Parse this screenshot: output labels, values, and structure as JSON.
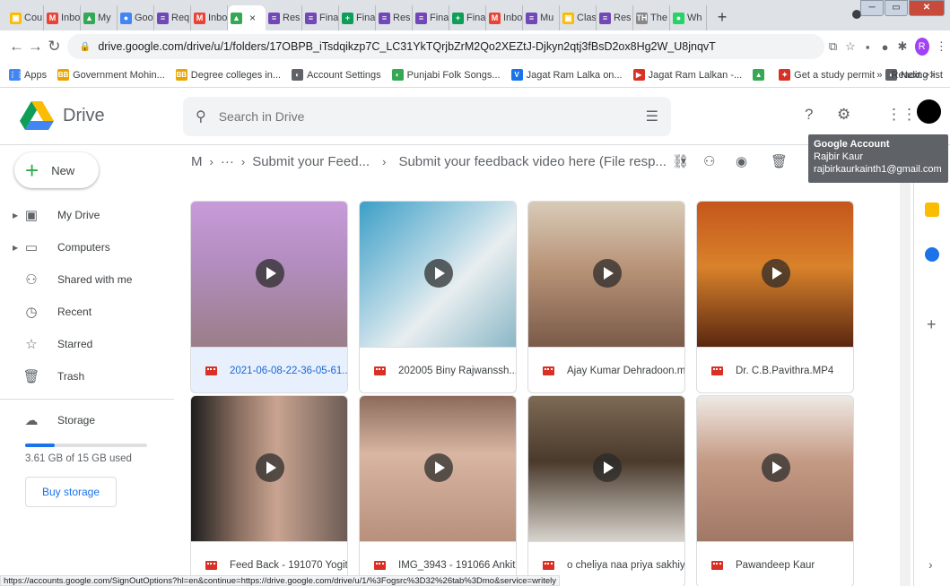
{
  "tabs": [
    {
      "label": "Cou",
      "color": "#fbbc04",
      "glyph": "▣"
    },
    {
      "label": "Inbo",
      "color": "#ea4335",
      "glyph": "M"
    },
    {
      "label": "My",
      "color": "#34a853",
      "glyph": "▲"
    },
    {
      "label": "Goo",
      "color": "#4285f4",
      "glyph": "●"
    },
    {
      "label": "Req",
      "color": "#7248b9",
      "glyph": "≡"
    },
    {
      "label": "Inbo",
      "color": "#ea4335",
      "glyph": "M"
    },
    {
      "label": "",
      "color": "#34a853",
      "glyph": "▲",
      "active": true
    },
    {
      "label": "Res",
      "color": "#7248b9",
      "glyph": "≡"
    },
    {
      "label": "Fina",
      "color": "#7248b9",
      "glyph": "≡"
    },
    {
      "label": "Fina",
      "color": "#0f9d58",
      "glyph": "+"
    },
    {
      "label": "Res",
      "color": "#7248b9",
      "glyph": "≡"
    },
    {
      "label": "Fina",
      "color": "#7248b9",
      "glyph": "≡"
    },
    {
      "label": "Fina",
      "color": "#0f9d58",
      "glyph": "+"
    },
    {
      "label": "Inbo",
      "color": "#ea4335",
      "glyph": "M"
    },
    {
      "label": "Mu",
      "color": "#7248b9",
      "glyph": "≡"
    },
    {
      "label": "Clas",
      "color": "#fbbc04",
      "glyph": "▣"
    },
    {
      "label": "Res",
      "color": "#7248b9",
      "glyph": "≡"
    },
    {
      "label": "The",
      "color": "#888888",
      "glyph": "TH"
    },
    {
      "label": "Wh",
      "color": "#25d366",
      "glyph": "●"
    }
  ],
  "address": {
    "url": "drive.google.com/drive/u/1/folders/17OBPB_iTsdqikzp7C_LC31YkTQrjbZrM2Qo2XEZtJ-Djkyn2qtj3fBsD2ox8Hg2W_U8jnqvT"
  },
  "bookmarks": [
    {
      "label": "Apps",
      "color": "#4285f4",
      "glyph": "⋮⋮"
    },
    {
      "label": "Government Mohin...",
      "color": "#e8a400",
      "glyph": "BB"
    },
    {
      "label": "Degree colleges in...",
      "color": "#e8a400",
      "glyph": "BB"
    },
    {
      "label": "Account Settings",
      "color": "#5f6368",
      "glyph": "◐"
    },
    {
      "label": "Punjabi Folk Songs...",
      "color": "#34a853",
      "glyph": "◐"
    },
    {
      "label": "Jagat Ram Lalka on...",
      "color": "#1a73e8",
      "glyph": "V"
    },
    {
      "label": "Jagat Ram Lalkan -...",
      "color": "#d93025",
      "glyph": "▶"
    },
    {
      "label": "",
      "color": "#34a853",
      "glyph": "▲"
    },
    {
      "label": "Get a study permit",
      "color": "#d93025",
      "glyph": "✦"
    },
    {
      "label": "Next >>",
      "color": "#5f6368",
      "glyph": "◐"
    }
  ],
  "bookmarks_more": "»",
  "reading_list": "Reading list",
  "drive": {
    "app_name": "Drive",
    "search_placeholder": "Search in Drive",
    "new_label": "New"
  },
  "account_tooltip": {
    "title": "Google Account",
    "name": "Rajbir Kaur",
    "email": "rajbirkaurkainth1@gmail.com"
  },
  "nav": [
    {
      "label": "My Drive",
      "icon": "my-drive-icon",
      "glyph": "▣",
      "caret": true
    },
    {
      "label": "Computers",
      "icon": "computer-icon",
      "glyph": "▭",
      "caret": true
    },
    {
      "label": "Shared with me",
      "icon": "shared-icon",
      "glyph": "⚇",
      "caret": false
    },
    {
      "label": "Recent",
      "icon": "clock-icon",
      "glyph": "◷",
      "caret": false
    },
    {
      "label": "Starred",
      "icon": "star-icon",
      "glyph": "☆",
      "caret": false
    },
    {
      "label": "Trash",
      "icon": "trash-icon",
      "glyph": "🗑",
      "caret": false
    }
  ],
  "storage": {
    "label": "Storage",
    "used_text": "3.61 GB of 15 GB used",
    "fraction_used": 0.24,
    "buy_label": "Buy storage"
  },
  "breadcrumb": {
    "root": "M",
    "ellipsis": "···",
    "folder1": "Submit your Feed...",
    "folder2": "Submit your feedback video here (File resp..."
  },
  "files": [
    {
      "name": "2021-06-08-22-36-05-61...",
      "selected": true,
      "bg": "linear-gradient(180deg,#c79bd8 0%,#b48ec2 40%,#9a7e88 100%)"
    },
    {
      "name": "202005 Biny Rajwanssh...",
      "selected": false,
      "bg": "linear-gradient(135deg,#3c9fc7 0%,#b9d9e6 45%,#e8eef0 60%,#8ab7c6 100%)"
    },
    {
      "name": "Ajay Kumar Dehradoon.m...",
      "selected": false,
      "bg": "linear-gradient(180deg,#d8cbb8 0%,#b99478 45%,#7a5a48 100%)"
    },
    {
      "name": "Dr. C.B.Pavithra.MP4",
      "selected": false,
      "bg": "linear-gradient(180deg,#c4561c 0%,#d9822b 45%,#5a2710 100%)"
    },
    {
      "name": "Feed Back - 191070 Yogit...",
      "selected": false,
      "bg": "linear-gradient(90deg,#1e1e1e 0%,#8a6e60 30%,#c9a491 55%,#6d5c55 100%)"
    },
    {
      "name": "IMG_3943 - 191066 Ankit...",
      "selected": false,
      "bg": "linear-gradient(180deg,#8c6b5c 0%,#d8b6a2 40%,#b8907c 100%)"
    },
    {
      "name": "o cheliya naa priya sakhiy...",
      "selected": false,
      "bg": "linear-gradient(180deg,#7d6a55 0%,#4a3a2c 45%,#d7d3cc 100%)"
    },
    {
      "name": "Pawandeep Kaur",
      "selected": false,
      "bg": "linear-gradient(180deg,#efe9e4 0%,#c49a84 45%,#a07865 100%)"
    }
  ],
  "status_url": "https://accounts.google.com/SignOutOptions?hl=en&continue=https://drive.google.com/drive/u/1/%3Fogsrc%3D32%26tab%3Dmo&service=writely"
}
